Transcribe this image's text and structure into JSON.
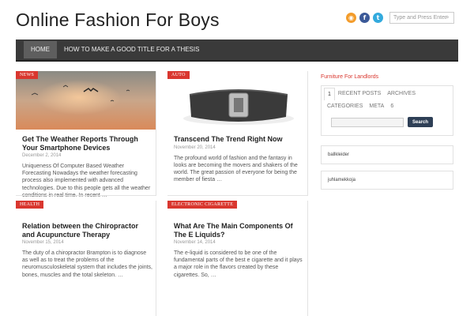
{
  "site": {
    "title": "Online Fashion For Boys"
  },
  "header": {
    "search_placeholder": "Type and Press Enter",
    "social": [
      "rss-icon",
      "facebook-icon",
      "twitter-icon"
    ]
  },
  "nav": {
    "items": [
      {
        "label": "HOME",
        "active": true
      },
      {
        "label": "HOW TO MAKE A GOOD TITLE FOR A THESIS",
        "active": false
      }
    ]
  },
  "posts": [
    {
      "category": "News",
      "title": "Get The Weather Reports Through Your Smartphone Devices",
      "date": "December 2, 2014",
      "excerpt": "Uniqueness Of Computer Based Weather Forecasting Nowadays the weather forecasting process also implemented with advanced technologies. Due to this people gets all the weather conditions in real time.  In recent …"
    },
    {
      "category": "Auto",
      "title": "Transcend The Trend Right Now",
      "date": "November 20, 2014",
      "excerpt": "The profound world of fashion and the fantasy in looks are becoming the movers and shakers of the world. The great passion of everyone for being the member of fiesta …"
    },
    {
      "category": "Health",
      "title": "Relation between the Chiropractor and Acupuncture Therapy",
      "date": "November 15, 2014",
      "excerpt": "The duty of a chiropractor Brampton is to diagnose as well as to treat the problems of the neuromusculoskeletal system that includes the joints, bones, muscles and the total skeleton. …"
    },
    {
      "category": "Electronic Cigarette",
      "title": "What Are The Main Components Of The E Liquids?",
      "date": "November 14, 2014",
      "excerpt": "The e-liquid is considered to be one of the fundamental parts of the best e cigarette and it plays a major role in the flavors created by these cigarettes. So, …"
    }
  ],
  "sidebar": {
    "link": "Furniture For Landlords",
    "tabs": [
      "1",
      "RECENT POSTS",
      "ARCHIVES",
      "CATEGORIES",
      "META",
      "6"
    ],
    "search_button": "Search",
    "widgets": [
      "ballkleider",
      "juhlamekkoja"
    ]
  }
}
